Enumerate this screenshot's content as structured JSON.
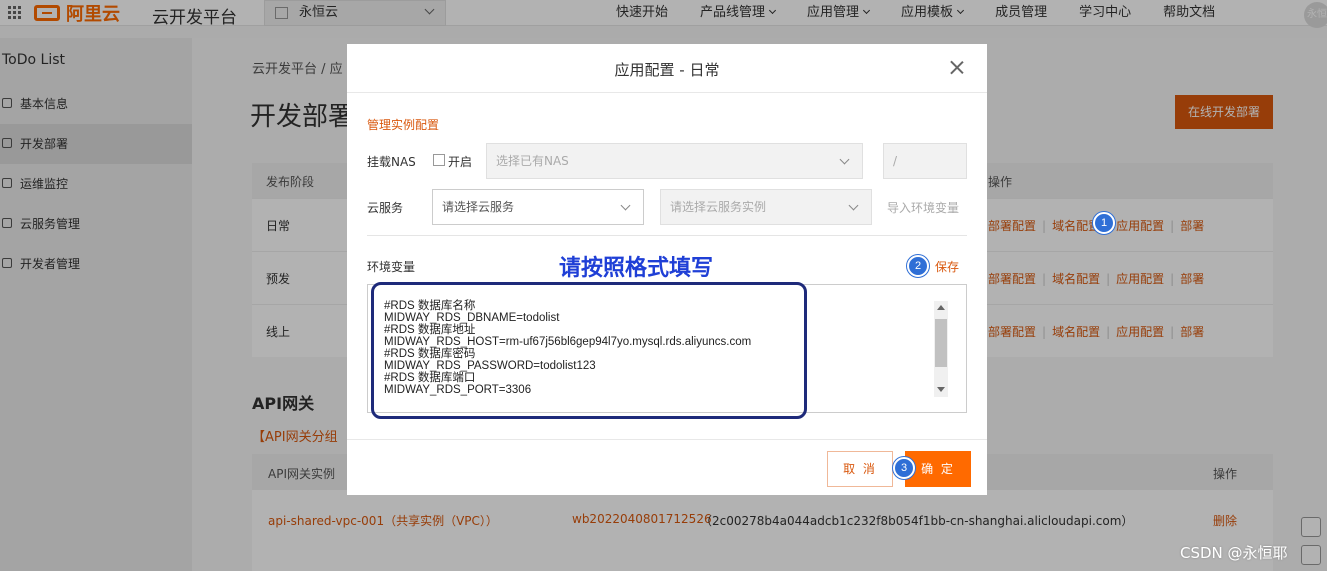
{
  "topnav": {
    "logo_text": "阿里云",
    "platform_title": "云开发平台",
    "project": "永恒云",
    "menu": [
      "快速开始",
      "产品线管理",
      "应用管理",
      "应用模板",
      "成员管理",
      "学习中心",
      "帮助文档"
    ],
    "user_initials": "永恒"
  },
  "sidebar": {
    "app_name": "ToDo List",
    "items": [
      {
        "label": "基本信息"
      },
      {
        "label": "开发部署"
      },
      {
        "label": "运维监控"
      },
      {
        "label": "云服务管理"
      },
      {
        "label": "开发者管理"
      }
    ]
  },
  "main": {
    "breadcrumb": "云开发平台 / 应",
    "page_title": "开发部署",
    "online_button": "在线开发部署",
    "stage_table": {
      "headers": [
        "发布阶段",
        "操作"
      ],
      "rows": [
        {
          "stage": "日常"
        },
        {
          "stage": "预发"
        },
        {
          "stage": "线上"
        }
      ],
      "ops": [
        "部署配置",
        "域名配置",
        "应用配置",
        "部署"
      ]
    },
    "api_title": "API网关",
    "api_group_link": "【API网关分组",
    "api_table": {
      "headers": [
        "API网关实例",
        "操作"
      ],
      "row": {
        "instance": "api-shared-vpc-001（共享实例（VPC））",
        "group_id": "wb20220408017125​26",
        "domain": "（2c00278b4a044adcb1c232f8b054f1bb-cn-shanghai.alicloudapi.com）",
        "action": "删除"
      }
    }
  },
  "modal": {
    "title": "应用配置 - 日常",
    "section": "管理实例配置",
    "nas_label": "挂载NAS",
    "nas_enable": "开启",
    "nas_placeholder": "选择已有NAS",
    "nas_path": "/",
    "cloud_label": "云服务",
    "cloud_select": "请选择云服务",
    "cloud_instance": "请选择云服务实例",
    "import_env": "导入环境变量",
    "env_label": "环境变量",
    "save": "保存",
    "env_lines": "#RDS 数据库名称\nMIDWAY_RDS_DBNAME=todolist\n#RDS 数据库地址\nMIDWAY_RDS_HOST=rm-uf67j56bl6gep94l7yo.mysql.rds.aliyuncs.com\n#RDS 数据库密码\nMIDWAY_RDS_PASSWORD=todolist123\n#RDS 数据库端口\nMIDWAY_RDS_PORT=3306",
    "annotation": "请按照格式填写",
    "cancel": "取 消",
    "ok": "确 定"
  },
  "badges": [
    "1",
    "2",
    "3"
  ],
  "watermark": "CSDN @永恒耶",
  "colors": {
    "accent": "#ff6a00",
    "link": "#d9580e",
    "badge": "#2f6fd6",
    "annotation": "#1f3fd6"
  }
}
